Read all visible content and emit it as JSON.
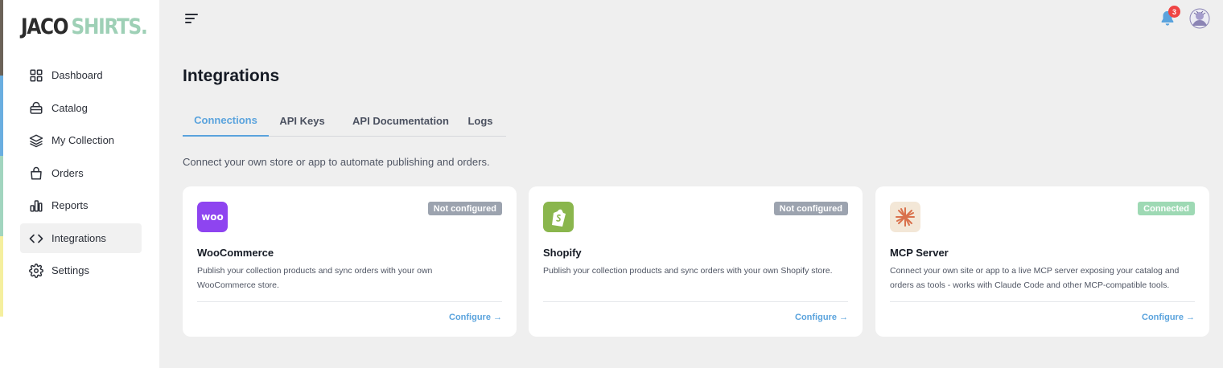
{
  "brand": {
    "part1": "JACO",
    "part2": "SHIRTS.",
    "part2_color": "#9ed0b6",
    "stripe_colors": [
      "#6b6258",
      "#6aaee0",
      "#a2d5bf",
      "#f5ef9e"
    ]
  },
  "sidebar": {
    "items": [
      {
        "label": "Dashboard",
        "icon": "grid-icon",
        "active": false
      },
      {
        "label": "Catalog",
        "icon": "basket-icon",
        "active": false
      },
      {
        "label": "My Collection",
        "icon": "layers-icon",
        "active": false
      },
      {
        "label": "Orders",
        "icon": "bag-icon",
        "active": false
      },
      {
        "label": "Reports",
        "icon": "bar-chart-icon",
        "active": false
      },
      {
        "label": "Integrations",
        "icon": "code-icon",
        "active": true
      },
      {
        "label": "Settings",
        "icon": "gear-icon",
        "active": false
      }
    ]
  },
  "topbar": {
    "menu_icon": "menu-icon",
    "notifications_icon": "bell-icon",
    "notifications_count": "3",
    "avatar_icon": "avatar-icon"
  },
  "page": {
    "title": "Integrations",
    "tabs": [
      {
        "label": "Connections",
        "active": true
      },
      {
        "label": "API Keys",
        "active": false
      },
      {
        "label": "API Documentation",
        "active": false
      },
      {
        "label": "Logs",
        "active": false
      }
    ],
    "intro": "Connect your own store or app to automate publishing and orders."
  },
  "cards": [
    {
      "name": "WooCommerce",
      "logo_icon": "woo-logo-icon",
      "logo_text": "woo",
      "logo_color": "#8e44f0",
      "status": "Not configured",
      "status_color": "#9ca3af",
      "description": "Publish your collection products and sync orders with your own WooCommerce store.",
      "action": "Configure →"
    },
    {
      "name": "Shopify",
      "logo_icon": "shopify-logo-icon",
      "logo_color": "#8ab64d",
      "status": "Not configured",
      "status_color": "#9ca3af",
      "description": "Publish your collection products and sync orders with your own Shopify store.",
      "action": "Configure →"
    },
    {
      "name": "MCP Server",
      "logo_icon": "mcp-logo-icon",
      "logo_color": "#f3e7d7",
      "status": "Connected",
      "status_color": "#9ed9b4",
      "description": "Connect your own site or app to a live MCP server exposing your catalog and orders as tools - works with Claude Code and other MCP-compatible tools.",
      "action": "Configure →"
    }
  ]
}
